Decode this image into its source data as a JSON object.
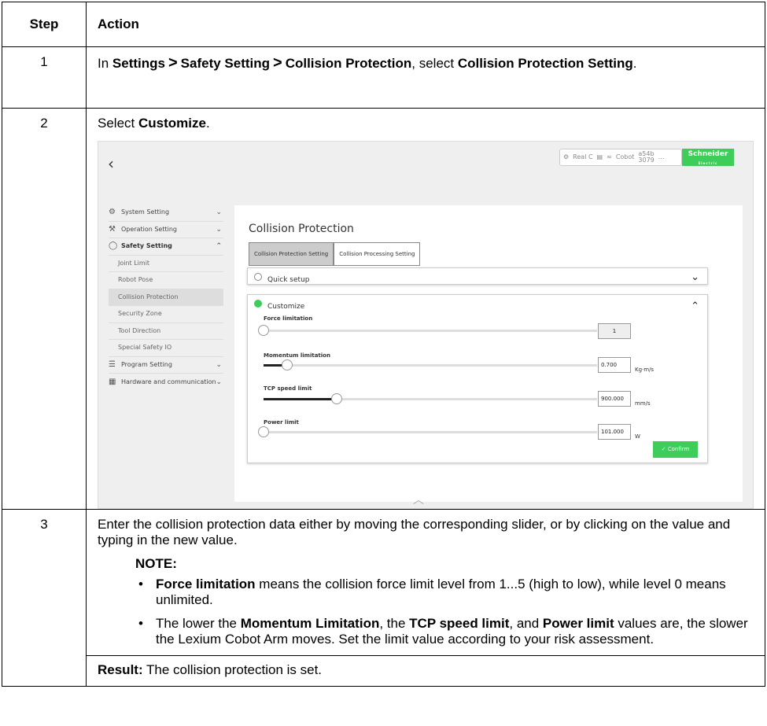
{
  "header": {
    "step": "Step",
    "action": "Action"
  },
  "rows": {
    "r1": {
      "num": "1",
      "pre": "In ",
      "a": "Settings",
      "b": "Safety Setting",
      "c": "Collision Protection",
      "mid": ", select ",
      "d": "Collision Protection Setting",
      "end": "."
    },
    "r2": {
      "num": "2",
      "pre": "Select ",
      "b": "Customize",
      "end": "."
    },
    "r3": {
      "num": "3",
      "text": "Enter the collision protection data either by moving the corresponding slider, or by clicking on the value and typing in the new value.",
      "note": "NOTE:",
      "n1a": "Force limitation",
      "n1b": " means the collision force limit level from 1...5 (high to low), while level 0 means unlimited.",
      "n2a": "The lower the ",
      "n2b": "Momentum Limitation",
      "n2c": ", the ",
      "n2d": "TCP speed limit",
      "n2e": ", and ",
      "n2f": "Power limit",
      "n2g": " values are, the slower the Lexium Cobot Arm moves. Set the limit value according to your risk assessment.",
      "result": "Result:",
      "result_text": " The collision protection is set."
    }
  },
  "separator": ">",
  "app": {
    "status": {
      "real": "Real C",
      "cobot": "Cobot",
      "id1": "a54b",
      "id2": "3079",
      "more": "..."
    },
    "brand": {
      "name": "Schneider",
      "sub": "Electric"
    },
    "sidebar": [
      "System Setting",
      "Operation Setting",
      "Safety Setting",
      "Joint Limit",
      "Robot Pose",
      "Collision Protection",
      "Security Zone",
      "Tool Direction",
      "Special Safety IO",
      "Program Setting",
      "Hardware and communication"
    ],
    "title": "Collision Protection",
    "tabs": [
      "Collision Protection Setting",
      "Collision Processing Setting"
    ],
    "quick": "Quick setup",
    "customize": "Customize",
    "force": {
      "label": "Force limitation",
      "value": "1",
      "level": 0
    },
    "momentum": {
      "label": "Momentum limitation",
      "value": "0.700",
      "unit": "Kg·m/s",
      "level": 0.07
    },
    "tcp": {
      "label": "TCP speed limit",
      "value": "900.000",
      "unit": "mm/s",
      "level": 0.22
    },
    "power": {
      "label": "Power limit",
      "value": "101.000",
      "unit": "W",
      "level": 0
    },
    "confirm": "Confirm"
  }
}
